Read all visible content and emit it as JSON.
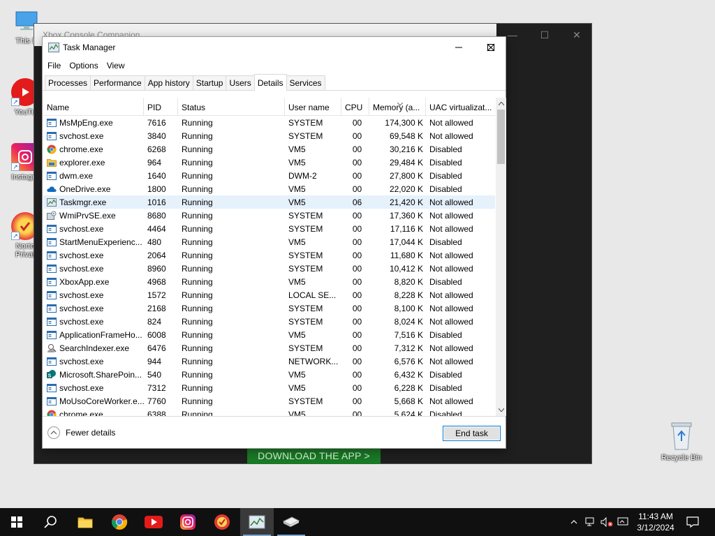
{
  "desktop": {
    "icons": [
      {
        "label": "This P",
        "icon": "this-pc-icon"
      },
      {
        "label": "YouTu",
        "icon": "youtube-icon"
      },
      {
        "label": "Instagra",
        "icon": "instagram-icon"
      },
      {
        "label_line1": "Norto",
        "label_line2": "Privat",
        "icon": "norton-icon"
      }
    ],
    "recycle_bin": {
      "label": "Recycle Bin",
      "icon": "recycle-bin-icon"
    }
  },
  "background_window": {
    "title": "Xbox Console Companion",
    "download_banner": "DOWNLOAD THE APP >",
    "banner_color": "#1a7a26"
  },
  "task_manager": {
    "title": "Task Manager",
    "menu": [
      "File",
      "Options",
      "View"
    ],
    "tabs": [
      "Processes",
      "Performance",
      "App history",
      "Startup",
      "Users",
      "Details",
      "Services"
    ],
    "active_tab": "Details",
    "columns": [
      "Name",
      "PID",
      "Status",
      "User name",
      "CPU",
      "Memory (a...",
      "UAC virtualizat..."
    ],
    "rows": [
      {
        "name": "MsMpEng.exe",
        "pid": "7616",
        "status": "Running",
        "user": "SYSTEM",
        "cpu": "00",
        "memory": "174,300 K",
        "uac": "Not allowed",
        "icon": "service-icon"
      },
      {
        "name": "svchost.exe",
        "pid": "3840",
        "status": "Running",
        "user": "SYSTEM",
        "cpu": "00",
        "memory": "69,548 K",
        "uac": "Not allowed",
        "icon": "service-icon"
      },
      {
        "name": "chrome.exe",
        "pid": "6268",
        "status": "Running",
        "user": "VM5",
        "cpu": "00",
        "memory": "30,216 K",
        "uac": "Disabled",
        "icon": "chrome-icon"
      },
      {
        "name": "explorer.exe",
        "pid": "964",
        "status": "Running",
        "user": "VM5",
        "cpu": "00",
        "memory": "29,484 K",
        "uac": "Disabled",
        "icon": "folder-icon"
      },
      {
        "name": "dwm.exe",
        "pid": "1640",
        "status": "Running",
        "user": "DWM-2",
        "cpu": "00",
        "memory": "27,800 K",
        "uac": "Disabled",
        "icon": "service-icon"
      },
      {
        "name": "OneDrive.exe",
        "pid": "1800",
        "status": "Running",
        "user": "VM5",
        "cpu": "00",
        "memory": "22,020 K",
        "uac": "Disabled",
        "icon": "onedrive-icon"
      },
      {
        "name": "Taskmgr.exe",
        "pid": "1016",
        "status": "Running",
        "user": "VM5",
        "cpu": "06",
        "memory": "21,420 K",
        "uac": "Not allowed",
        "icon": "task-manager-icon",
        "selected": true
      },
      {
        "name": "WmiPrvSE.exe",
        "pid": "8680",
        "status": "Running",
        "user": "SYSTEM",
        "cpu": "00",
        "memory": "17,360 K",
        "uac": "Not allowed",
        "icon": "wmi-icon"
      },
      {
        "name": "svchost.exe",
        "pid": "4464",
        "status": "Running",
        "user": "SYSTEM",
        "cpu": "00",
        "memory": "17,116 K",
        "uac": "Not allowed",
        "icon": "service-icon"
      },
      {
        "name": "StartMenuExperienc...",
        "pid": "480",
        "status": "Running",
        "user": "VM5",
        "cpu": "00",
        "memory": "17,044 K",
        "uac": "Disabled",
        "icon": "service-icon"
      },
      {
        "name": "svchost.exe",
        "pid": "2064",
        "status": "Running",
        "user": "SYSTEM",
        "cpu": "00",
        "memory": "11,680 K",
        "uac": "Not allowed",
        "icon": "service-icon"
      },
      {
        "name": "svchost.exe",
        "pid": "8960",
        "status": "Running",
        "user": "SYSTEM",
        "cpu": "00",
        "memory": "10,412 K",
        "uac": "Not allowed",
        "icon": "service-icon"
      },
      {
        "name": "XboxApp.exe",
        "pid": "4968",
        "status": "Running",
        "user": "VM5",
        "cpu": "00",
        "memory": "8,820 K",
        "uac": "Disabled",
        "icon": "service-icon"
      },
      {
        "name": "svchost.exe",
        "pid": "1572",
        "status": "Running",
        "user": "LOCAL SE...",
        "cpu": "00",
        "memory": "8,228 K",
        "uac": "Not allowed",
        "icon": "service-icon"
      },
      {
        "name": "svchost.exe",
        "pid": "2168",
        "status": "Running",
        "user": "SYSTEM",
        "cpu": "00",
        "memory": "8,100 K",
        "uac": "Not allowed",
        "icon": "service-icon"
      },
      {
        "name": "svchost.exe",
        "pid": "824",
        "status": "Running",
        "user": "SYSTEM",
        "cpu": "00",
        "memory": "8,024 K",
        "uac": "Not allowed",
        "icon": "service-icon"
      },
      {
        "name": "ApplicationFrameHo...",
        "pid": "6008",
        "status": "Running",
        "user": "VM5",
        "cpu": "00",
        "memory": "7,516 K",
        "uac": "Disabled",
        "icon": "service-icon"
      },
      {
        "name": "SearchIndexer.exe",
        "pid": "6476",
        "status": "Running",
        "user": "SYSTEM",
        "cpu": "00",
        "memory": "7,312 K",
        "uac": "Not allowed",
        "icon": "search-indexer-icon"
      },
      {
        "name": "svchost.exe",
        "pid": "944",
        "status": "Running",
        "user": "NETWORK...",
        "cpu": "00",
        "memory": "6,576 K",
        "uac": "Not allowed",
        "icon": "service-icon"
      },
      {
        "name": "Microsoft.SharePoin...",
        "pid": "540",
        "status": "Running",
        "user": "VM5",
        "cpu": "00",
        "memory": "6,432 K",
        "uac": "Disabled",
        "icon": "sharepoint-icon"
      },
      {
        "name": "svchost.exe",
        "pid": "7312",
        "status": "Running",
        "user": "VM5",
        "cpu": "00",
        "memory": "6,228 K",
        "uac": "Disabled",
        "icon": "service-icon"
      },
      {
        "name": "MoUsoCoreWorker.e...",
        "pid": "7760",
        "status": "Running",
        "user": "SYSTEM",
        "cpu": "00",
        "memory": "5,668 K",
        "uac": "Not allowed",
        "icon": "service-icon"
      },
      {
        "name": "chrome.exe",
        "pid": "6388",
        "status": "Running",
        "user": "VM5",
        "cpu": "00",
        "memory": "5,624 K",
        "uac": "Disabled",
        "icon": "chrome-icon"
      }
    ],
    "fewer_details": "Fewer details",
    "end_task": "End task"
  },
  "taskbar": {
    "apps": [
      "start-icon",
      "search-icon",
      "file-explorer-icon",
      "chrome-icon",
      "youtube-icon",
      "instagram-icon",
      "norton-icon",
      "task-manager-icon",
      "xbox-icon"
    ],
    "tray_icons": [
      "chevron-up-icon",
      "network-icon",
      "volume-muted-icon",
      "notification-icon"
    ],
    "time": "11:43 AM",
    "date": "3/12/2024",
    "accent": "#0078d7"
  }
}
